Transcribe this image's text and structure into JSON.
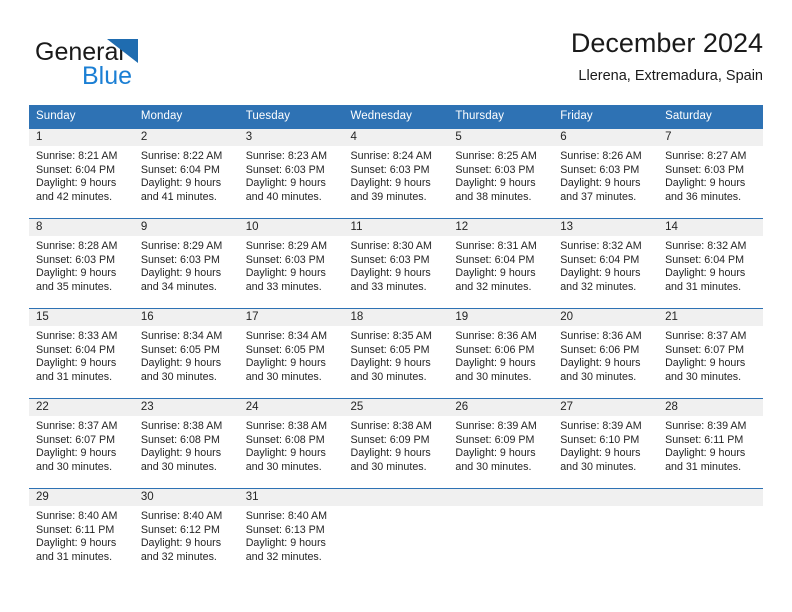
{
  "brand": {
    "name_primary": "General",
    "name_secondary": "Blue",
    "primary_color": "#1a1a1a",
    "secondary_color": "#1b7fd4",
    "triangle_color": "#1f6cb0",
    "logo_icon": "triangle-logo-icon"
  },
  "header": {
    "title": "December 2024",
    "subtitle": "Llerena, Extremadura, Spain"
  },
  "theme": {
    "header_bg": "#2e72b4",
    "header_text": "#ffffff",
    "daynum_band_bg": "#f0f0f0",
    "cell_border_top": "#2e72b4",
    "body_text": "#242424"
  },
  "weekdays": [
    "Sunday",
    "Monday",
    "Tuesday",
    "Wednesday",
    "Thursday",
    "Friday",
    "Saturday"
  ],
  "weeks": [
    [
      {
        "day": "1",
        "sunrise": "Sunrise: 8:21 AM",
        "sunset": "Sunset: 6:04 PM",
        "daylight_line1": "Daylight: 9 hours",
        "daylight_line2": "and 42 minutes."
      },
      {
        "day": "2",
        "sunrise": "Sunrise: 8:22 AM",
        "sunset": "Sunset: 6:04 PM",
        "daylight_line1": "Daylight: 9 hours",
        "daylight_line2": "and 41 minutes."
      },
      {
        "day": "3",
        "sunrise": "Sunrise: 8:23 AM",
        "sunset": "Sunset: 6:03 PM",
        "daylight_line1": "Daylight: 9 hours",
        "daylight_line2": "and 40 minutes."
      },
      {
        "day": "4",
        "sunrise": "Sunrise: 8:24 AM",
        "sunset": "Sunset: 6:03 PM",
        "daylight_line1": "Daylight: 9 hours",
        "daylight_line2": "and 39 minutes."
      },
      {
        "day": "5",
        "sunrise": "Sunrise: 8:25 AM",
        "sunset": "Sunset: 6:03 PM",
        "daylight_line1": "Daylight: 9 hours",
        "daylight_line2": "and 38 minutes."
      },
      {
        "day": "6",
        "sunrise": "Sunrise: 8:26 AM",
        "sunset": "Sunset: 6:03 PM",
        "daylight_line1": "Daylight: 9 hours",
        "daylight_line2": "and 37 minutes."
      },
      {
        "day": "7",
        "sunrise": "Sunrise: 8:27 AM",
        "sunset": "Sunset: 6:03 PM",
        "daylight_line1": "Daylight: 9 hours",
        "daylight_line2": "and 36 minutes."
      }
    ],
    [
      {
        "day": "8",
        "sunrise": "Sunrise: 8:28 AM",
        "sunset": "Sunset: 6:03 PM",
        "daylight_line1": "Daylight: 9 hours",
        "daylight_line2": "and 35 minutes."
      },
      {
        "day": "9",
        "sunrise": "Sunrise: 8:29 AM",
        "sunset": "Sunset: 6:03 PM",
        "daylight_line1": "Daylight: 9 hours",
        "daylight_line2": "and 34 minutes."
      },
      {
        "day": "10",
        "sunrise": "Sunrise: 8:29 AM",
        "sunset": "Sunset: 6:03 PM",
        "daylight_line1": "Daylight: 9 hours",
        "daylight_line2": "and 33 minutes."
      },
      {
        "day": "11",
        "sunrise": "Sunrise: 8:30 AM",
        "sunset": "Sunset: 6:03 PM",
        "daylight_line1": "Daylight: 9 hours",
        "daylight_line2": "and 33 minutes."
      },
      {
        "day": "12",
        "sunrise": "Sunrise: 8:31 AM",
        "sunset": "Sunset: 6:04 PM",
        "daylight_line1": "Daylight: 9 hours",
        "daylight_line2": "and 32 minutes."
      },
      {
        "day": "13",
        "sunrise": "Sunrise: 8:32 AM",
        "sunset": "Sunset: 6:04 PM",
        "daylight_line1": "Daylight: 9 hours",
        "daylight_line2": "and 32 minutes."
      },
      {
        "day": "14",
        "sunrise": "Sunrise: 8:32 AM",
        "sunset": "Sunset: 6:04 PM",
        "daylight_line1": "Daylight: 9 hours",
        "daylight_line2": "and 31 minutes."
      }
    ],
    [
      {
        "day": "15",
        "sunrise": "Sunrise: 8:33 AM",
        "sunset": "Sunset: 6:04 PM",
        "daylight_line1": "Daylight: 9 hours",
        "daylight_line2": "and 31 minutes."
      },
      {
        "day": "16",
        "sunrise": "Sunrise: 8:34 AM",
        "sunset": "Sunset: 6:05 PM",
        "daylight_line1": "Daylight: 9 hours",
        "daylight_line2": "and 30 minutes."
      },
      {
        "day": "17",
        "sunrise": "Sunrise: 8:34 AM",
        "sunset": "Sunset: 6:05 PM",
        "daylight_line1": "Daylight: 9 hours",
        "daylight_line2": "and 30 minutes."
      },
      {
        "day": "18",
        "sunrise": "Sunrise: 8:35 AM",
        "sunset": "Sunset: 6:05 PM",
        "daylight_line1": "Daylight: 9 hours",
        "daylight_line2": "and 30 minutes."
      },
      {
        "day": "19",
        "sunrise": "Sunrise: 8:36 AM",
        "sunset": "Sunset: 6:06 PM",
        "daylight_line1": "Daylight: 9 hours",
        "daylight_line2": "and 30 minutes."
      },
      {
        "day": "20",
        "sunrise": "Sunrise: 8:36 AM",
        "sunset": "Sunset: 6:06 PM",
        "daylight_line1": "Daylight: 9 hours",
        "daylight_line2": "and 30 minutes."
      },
      {
        "day": "21",
        "sunrise": "Sunrise: 8:37 AM",
        "sunset": "Sunset: 6:07 PM",
        "daylight_line1": "Daylight: 9 hours",
        "daylight_line2": "and 30 minutes."
      }
    ],
    [
      {
        "day": "22",
        "sunrise": "Sunrise: 8:37 AM",
        "sunset": "Sunset: 6:07 PM",
        "daylight_line1": "Daylight: 9 hours",
        "daylight_line2": "and 30 minutes."
      },
      {
        "day": "23",
        "sunrise": "Sunrise: 8:38 AM",
        "sunset": "Sunset: 6:08 PM",
        "daylight_line1": "Daylight: 9 hours",
        "daylight_line2": "and 30 minutes."
      },
      {
        "day": "24",
        "sunrise": "Sunrise: 8:38 AM",
        "sunset": "Sunset: 6:08 PM",
        "daylight_line1": "Daylight: 9 hours",
        "daylight_line2": "and 30 minutes."
      },
      {
        "day": "25",
        "sunrise": "Sunrise: 8:38 AM",
        "sunset": "Sunset: 6:09 PM",
        "daylight_line1": "Daylight: 9 hours",
        "daylight_line2": "and 30 minutes."
      },
      {
        "day": "26",
        "sunrise": "Sunrise: 8:39 AM",
        "sunset": "Sunset: 6:09 PM",
        "daylight_line1": "Daylight: 9 hours",
        "daylight_line2": "and 30 minutes."
      },
      {
        "day": "27",
        "sunrise": "Sunrise: 8:39 AM",
        "sunset": "Sunset: 6:10 PM",
        "daylight_line1": "Daylight: 9 hours",
        "daylight_line2": "and 30 minutes."
      },
      {
        "day": "28",
        "sunrise": "Sunrise: 8:39 AM",
        "sunset": "Sunset: 6:11 PM",
        "daylight_line1": "Daylight: 9 hours",
        "daylight_line2": "and 31 minutes."
      }
    ],
    [
      {
        "day": "29",
        "sunrise": "Sunrise: 8:40 AM",
        "sunset": "Sunset: 6:11 PM",
        "daylight_line1": "Daylight: 9 hours",
        "daylight_line2": "and 31 minutes."
      },
      {
        "day": "30",
        "sunrise": "Sunrise: 8:40 AM",
        "sunset": "Sunset: 6:12 PM",
        "daylight_line1": "Daylight: 9 hours",
        "daylight_line2": "and 32 minutes."
      },
      {
        "day": "31",
        "sunrise": "Sunrise: 8:40 AM",
        "sunset": "Sunset: 6:13 PM",
        "daylight_line1": "Daylight: 9 hours",
        "daylight_line2": "and 32 minutes."
      },
      {
        "day": "",
        "sunrise": "",
        "sunset": "",
        "daylight_line1": "",
        "daylight_line2": ""
      },
      {
        "day": "",
        "sunrise": "",
        "sunset": "",
        "daylight_line1": "",
        "daylight_line2": ""
      },
      {
        "day": "",
        "sunrise": "",
        "sunset": "",
        "daylight_line1": "",
        "daylight_line2": ""
      },
      {
        "day": "",
        "sunrise": "",
        "sunset": "",
        "daylight_line1": "",
        "daylight_line2": ""
      }
    ]
  ]
}
